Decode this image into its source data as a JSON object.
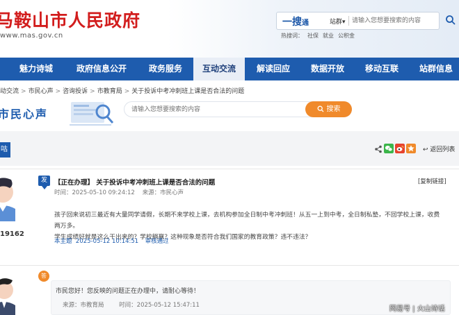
{
  "header": {
    "site_title": "马鞍山市人民政府",
    "domain": "www.mas.gov.cn",
    "search_brand": "一搜",
    "search_brand_small": "通",
    "search_scope": "站群▾",
    "search_placeholder": "请输入您想要搜索的内容",
    "hot_label": "热搜词：",
    "hot_words": [
      "社保",
      "就业",
      "公积金"
    ]
  },
  "nav": {
    "items": [
      "魅力诗城",
      "政府信息公开",
      "政务服务",
      "互动交流",
      "解读回应",
      "数据开放",
      "移动互联",
      "站群信息"
    ],
    "active": "互动交流"
  },
  "breadcrumb": [
    "动交流",
    "市民心声",
    "咨询投诉",
    "市教育局",
    "关于投诉中考冲刺班上课是否合法的问题"
  ],
  "banner": {
    "title": "市民心声",
    "search_placeholder": "请输入您想要搜索的内容",
    "search_button": "搜索"
  },
  "band": {
    "tab_label": "咕",
    "back_label": "返回列表"
  },
  "post": {
    "badge": "发",
    "title": "【正在办理】 关于投诉中考冲刺班上课是否合法的问题",
    "copy_link": "[复制链接]",
    "time_label": "时间：",
    "time": "2025-05-10 09:24:12",
    "source_label": "来源：",
    "source": "市民心声",
    "body_lines": [
      "孩子回来说初三最近有大量同学请假，长期不来学校上课，去机构参加全日制中考冲刺班！从五一上到中考，全日制私塾，不回学校上课，收费两万多。",
      "学生成绩好就是这么干出来的？学校躺赢？这种现象是否符合我们国家的教育政策？违不违法？"
    ],
    "user_id": "19162",
    "foot_label": "本主题",
    "foot_time": "2025-05-12 10:14:51",
    "foot_status": "审核通过"
  },
  "reply": {
    "badge": "答",
    "text": "市民您好！您反映的问题正在办理中，请耐心等待！",
    "source_label": "来源：",
    "source": "市教育局",
    "time_label": "时间：",
    "time": "2025-05-12 15:47:11"
  },
  "watermark": "网易号 | 火山诗话",
  "colors": {
    "brand_red": "#d21d1d",
    "nav_blue": "#1e5cae",
    "accent_orange": "#f08a2b"
  }
}
